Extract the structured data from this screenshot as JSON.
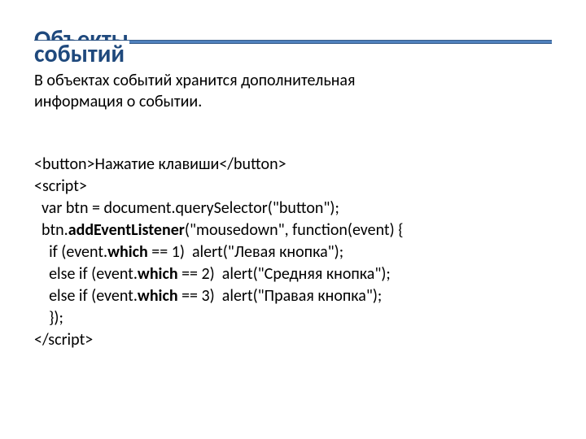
{
  "title_line1": "Объекты",
  "title_line2": "событий",
  "intro_line1": "В объектах событий хранится дополнительная",
  "intro_line2": "информация о событии.",
  "code": {
    "l1a": "<button>",
    "l1b": "Нажатие клавиши",
    "l1c": "</button>",
    "l2": "<script>",
    "l3": "  var btn = document.querySelector(\"button\");",
    "l4a": "  btn.",
    "l4b": "addEventListener",
    "l4c": "(\"mousedown\", function(event) {",
    "l5a": "    if (event.",
    "l5b": "which",
    "l5c": " == 1)  alert(\"Левая кнопка\");",
    "l6a": "    else if (event.",
    "l6b": "which",
    "l6c": " == 2)  alert(\"Средняя кнопка\");",
    "l7a": "    else if (event.",
    "l7b": "which",
    "l7c": " == 3)  alert(\"Правая кнопка\");",
    "l8": "    });",
    "l9": "</script>"
  }
}
